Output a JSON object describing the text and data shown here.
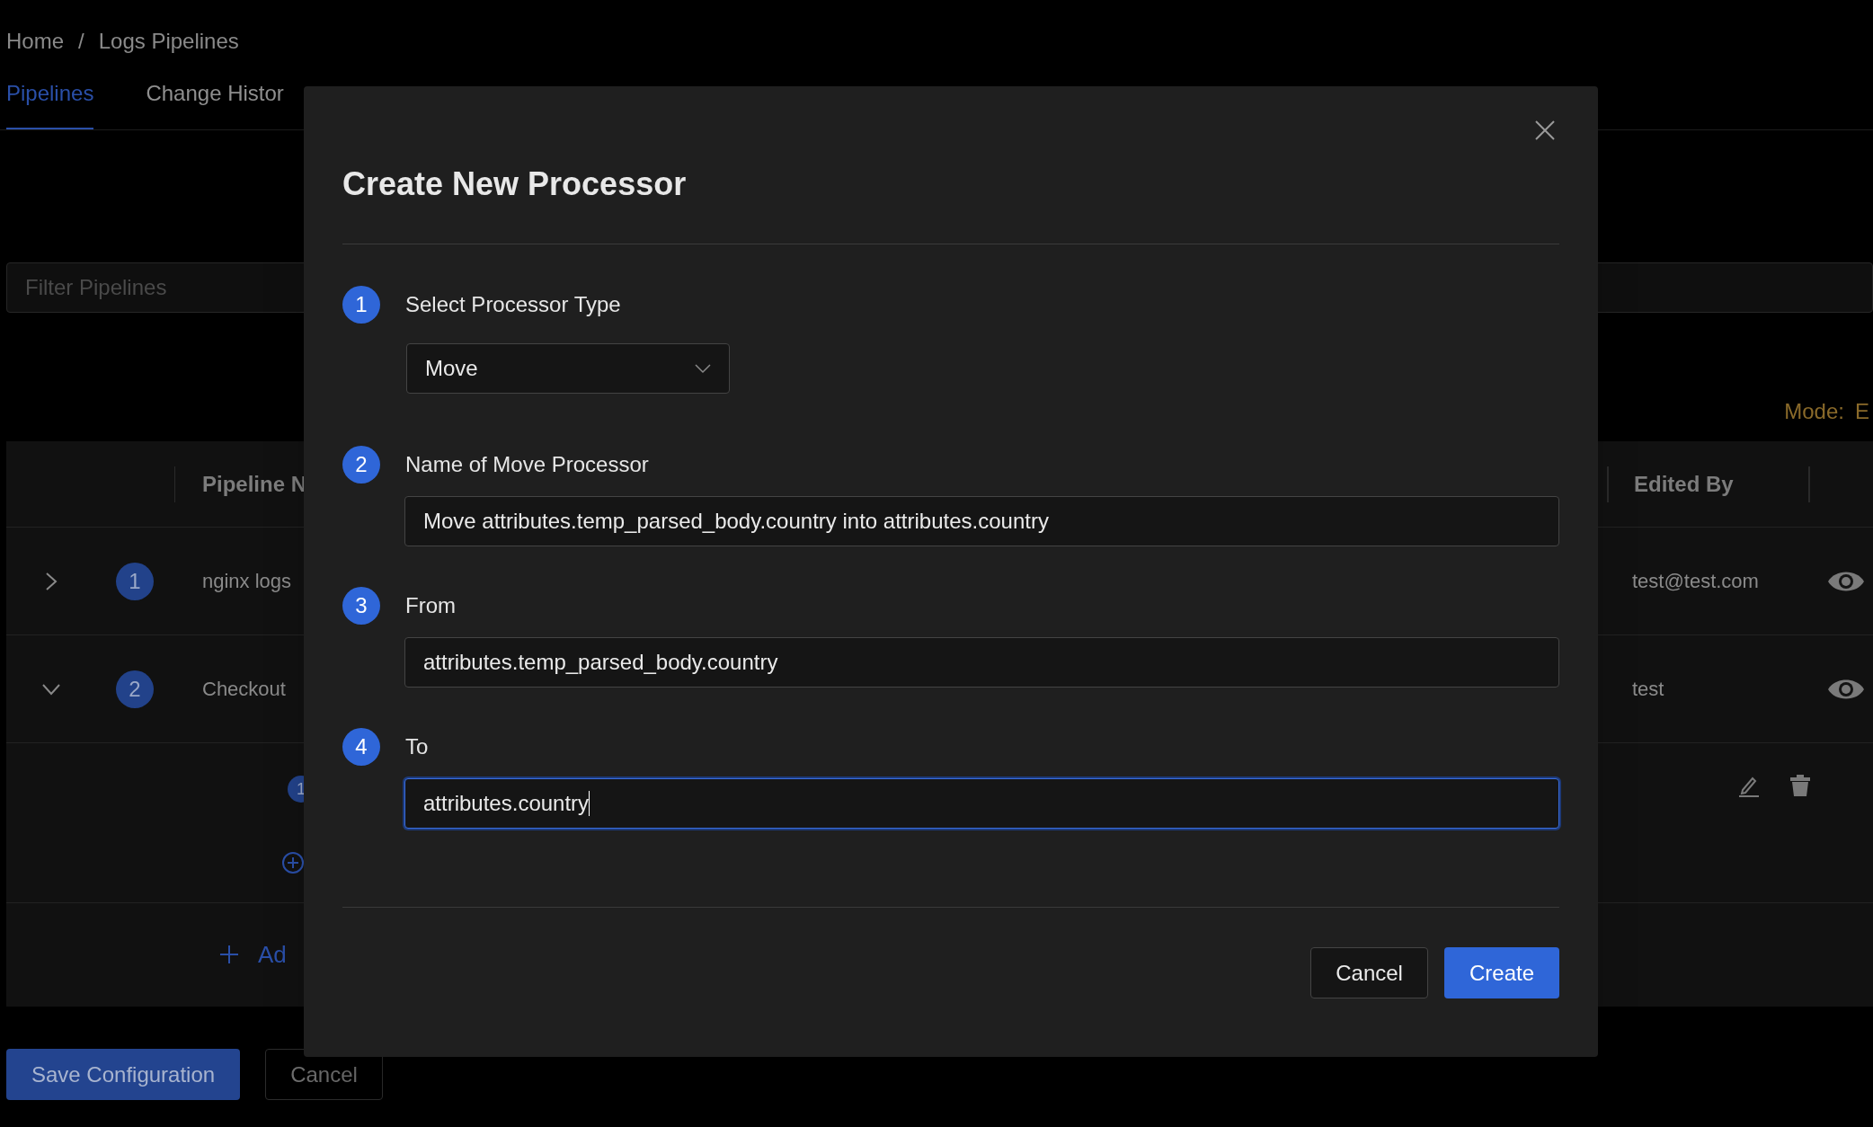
{
  "breadcrumb": [
    {
      "label": "Home"
    },
    {
      "label": "Logs Pipelines"
    }
  ],
  "breadcrumb_separator": "/",
  "tabs": [
    {
      "label": "Pipelines",
      "selected": true
    },
    {
      "label": "Change Histor",
      "selected": false
    }
  ],
  "filter": {
    "placeholder": "Filter Pipelines"
  },
  "mode": {
    "label": "Mode:",
    "value": "E"
  },
  "table": {
    "columns": [
      "Pipeline N",
      "Edited By"
    ],
    "rows": [
      {
        "expanded": false,
        "index": "1",
        "name": "nginx logs",
        "edited_by": "test@test.com"
      },
      {
        "expanded": true,
        "index": "2",
        "name": "Checkout",
        "edited_by": "test"
      }
    ],
    "sub_row": {
      "index": "1"
    },
    "add_label": "Ad"
  },
  "footer": {
    "save": "Save Configuration",
    "cancel": "Cancel"
  },
  "modal": {
    "title": "Create New Processor",
    "steps": [
      {
        "number": "1",
        "label": "Select Processor Type",
        "kind": "select",
        "value": "Move",
        "focused": false
      },
      {
        "number": "2",
        "label": "Name of Move Processor",
        "kind": "input",
        "value": "Move attributes.temp_parsed_body.country into attributes.country",
        "focused": false
      },
      {
        "number": "3",
        "label": "From",
        "kind": "input",
        "value": "attributes.temp_parsed_body.country",
        "focused": false
      },
      {
        "number": "4",
        "label": "To",
        "kind": "input",
        "value": "attributes.country",
        "focused": true
      }
    ],
    "buttons": {
      "cancel": "Cancel",
      "create": "Create"
    }
  }
}
